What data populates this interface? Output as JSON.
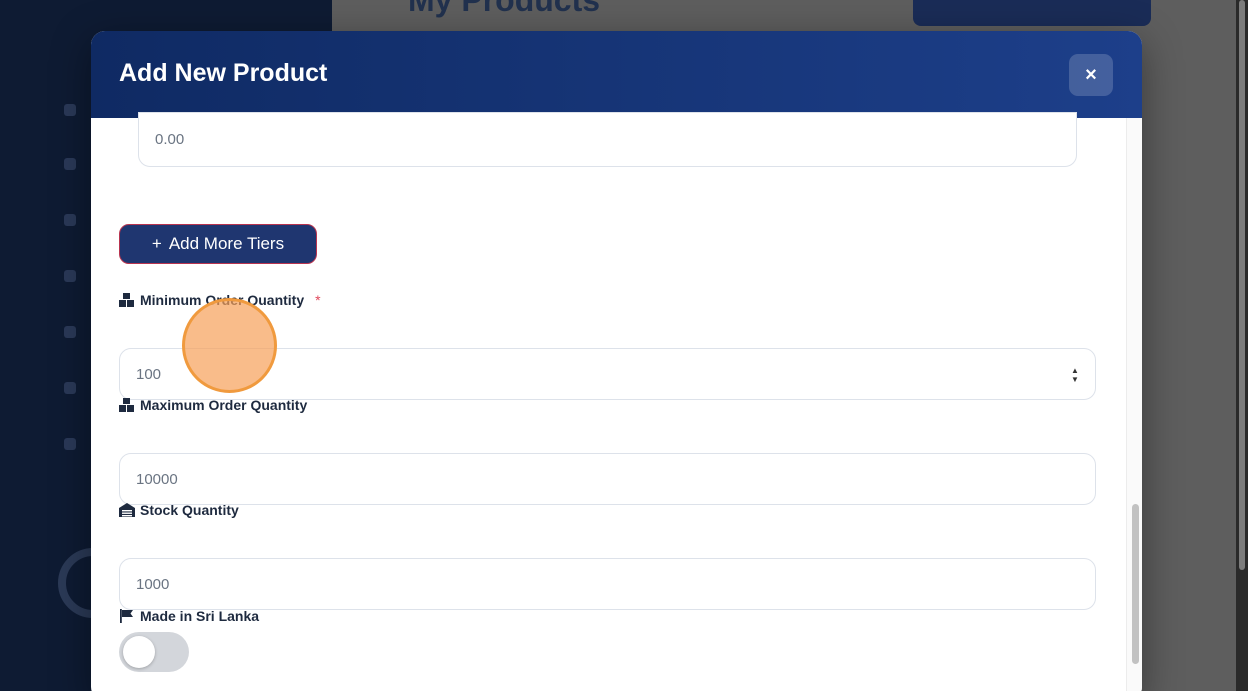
{
  "background": {
    "page_title": "My Products"
  },
  "modal": {
    "title": "Add New Product",
    "close_label": "×",
    "price_field": {
      "value": "0.00"
    },
    "add_tiers_button": {
      "plus": "+",
      "label": "Add More Tiers"
    },
    "min_order": {
      "label": "Minimum Order Quantity",
      "required_mark": "*",
      "value": "100",
      "icon": "boxes-icon"
    },
    "max_order": {
      "label": "Maximum Order Quantity",
      "value": "10000",
      "icon": "boxes-icon"
    },
    "stock": {
      "label": "Stock Quantity",
      "value": "1000",
      "icon": "warehouse-icon"
    },
    "made_in": {
      "label": "Made in Sri Lanka",
      "icon": "flag-icon",
      "toggle_on": false
    }
  },
  "colors": {
    "header_start": "#0f2a63",
    "header_end": "#1d3f8a",
    "button": "#1f3670",
    "required": "#e0475b",
    "click_marker": "#f09a3e"
  }
}
